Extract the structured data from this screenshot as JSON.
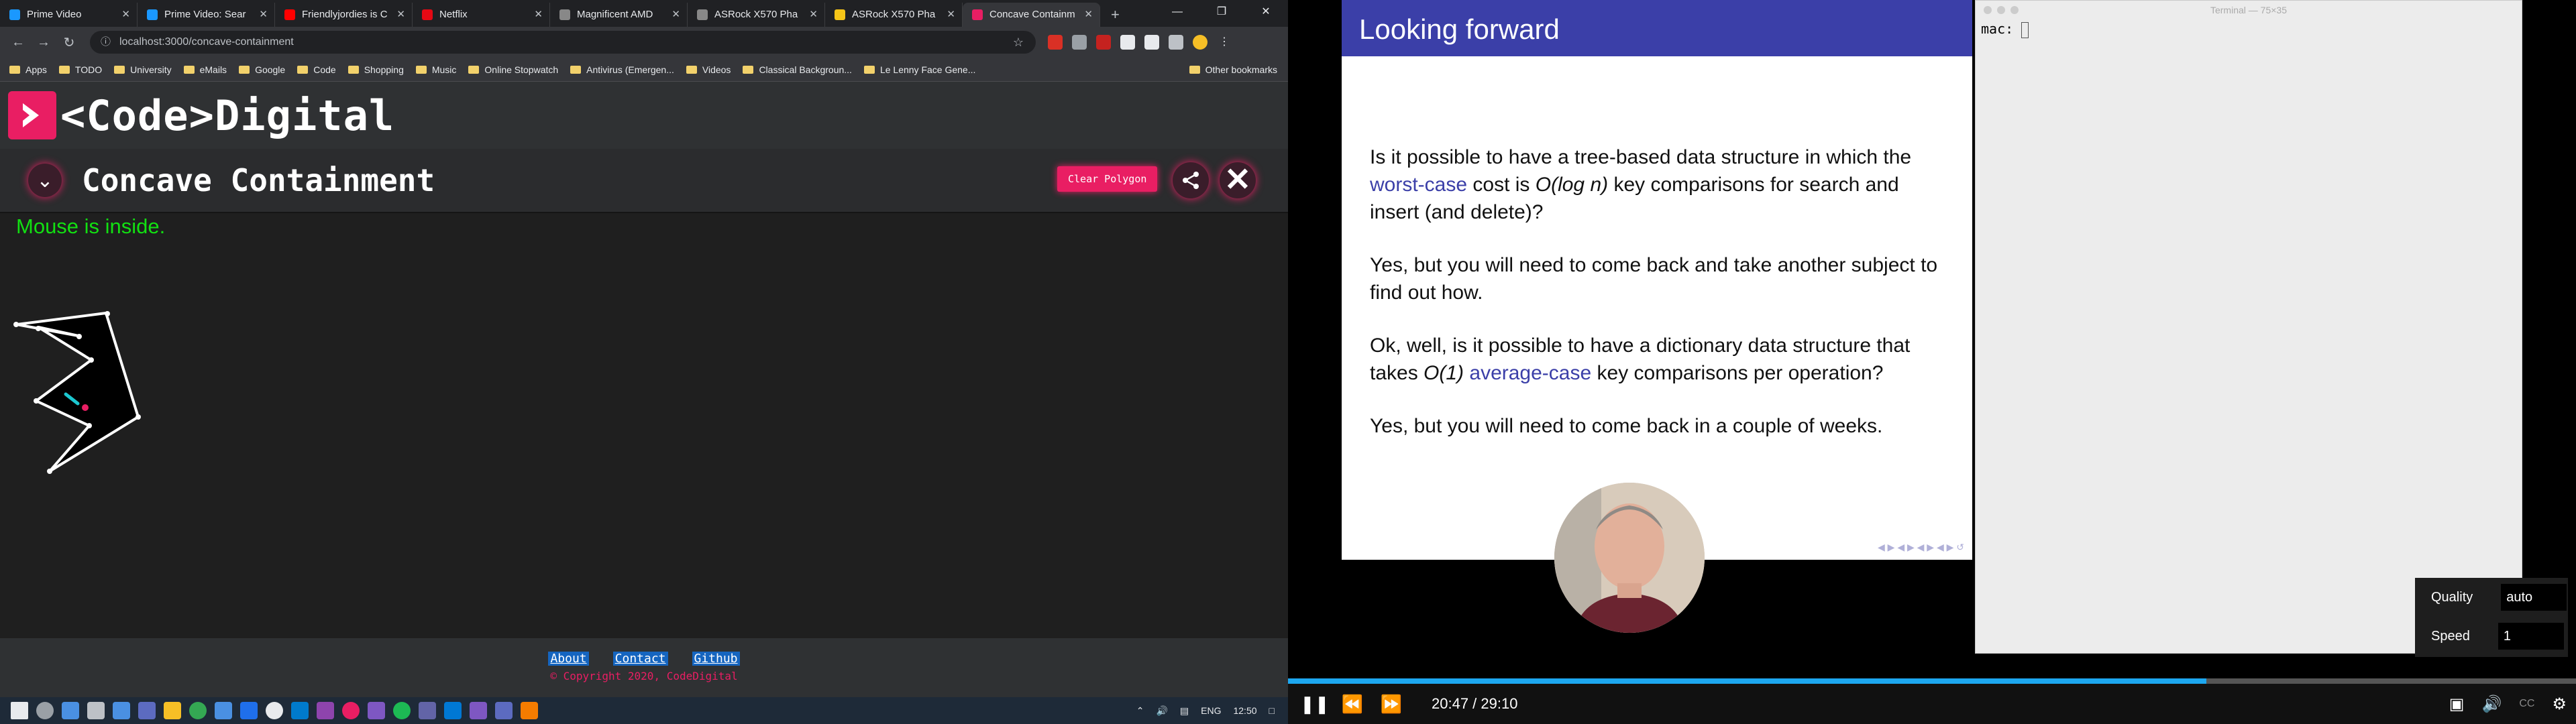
{
  "browser": {
    "tabs": [
      {
        "label": "Prime Video",
        "color": "#1a98ff"
      },
      {
        "label": "Prime Video: Sear",
        "color": "#1a98ff"
      },
      {
        "label": "Friendlyjordies is C",
        "color": "#ff0000"
      },
      {
        "label": "Netflix",
        "color": "#e50914"
      },
      {
        "label": "Magnificent AMD",
        "color": "#888888"
      },
      {
        "label": "ASRock X570 Pha",
        "color": "#888888"
      },
      {
        "label": "ASRock X570 Pha",
        "color": "#f5c518"
      },
      {
        "label": "Concave Containm",
        "color": "#e91e63"
      }
    ],
    "url": "localhost:3000/concave-containment",
    "bookmarks": [
      "Apps",
      "TODO",
      "University",
      "eMails",
      "Google",
      "Code",
      "Shopping",
      "Music",
      "Online Stopwatch",
      "Antivirus (Emergen...",
      "Videos",
      "Classical Backgroun...",
      "Le Lenny Face Gene..."
    ],
    "other_bookmarks": "Other bookmarks"
  },
  "site": {
    "brand": "<Code>Digital",
    "page_title": "Concave Containment",
    "clear_button": "Clear Polygon",
    "status": "Mouse is inside.",
    "footer_links": [
      "About",
      "Contact",
      "Github"
    ],
    "copyright": "© Copyright 2020, CodeDigital",
    "accent": "#e91e63",
    "status_color": "#12e012"
  },
  "taskbar": {
    "language": "ENG",
    "time": "12:50"
  },
  "slide": {
    "title": "Looking forward",
    "p1a": "Is it possible to have a tree-based data structure in which the ",
    "p1hl": "worst-case",
    "p1b": " cost is ",
    "p1math": "O(log n)",
    "p1c": " key comparisons for search and insert (and delete)?",
    "p2": "Yes, but you will need to come back and take another subject to find out how.",
    "p3a": "Ok, well, is it possible to have a dictionary data structure that takes ",
    "p3math": "O(1)",
    "p3hl": "average-case",
    "p3b": " key comparisons per operation?",
    "p4": "Yes, but you will need to come back in a couple of weeks."
  },
  "terminal": {
    "title": "Terminal — 75×35",
    "prompt": "mac:"
  },
  "video": {
    "time": "20:47 / 29:10",
    "progress": 0.713,
    "quality_label": "Quality",
    "quality_value": "auto",
    "speed_label": "Speed",
    "speed_value": "1",
    "cc": "CC"
  }
}
